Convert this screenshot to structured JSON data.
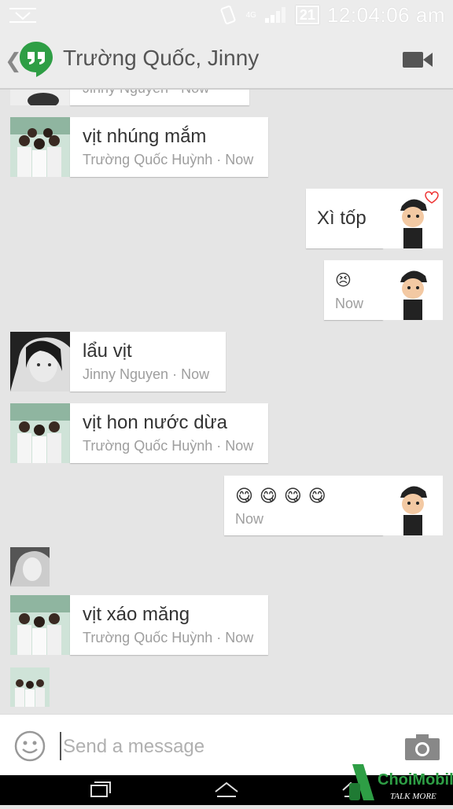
{
  "status_bar": {
    "network": "4G",
    "battery": "21",
    "time": "12:04:06 am"
  },
  "app_bar": {
    "title": "Trường Quốc, Jinny"
  },
  "messages": [
    {
      "direction": "in",
      "avatar": "group-photo",
      "text": "vịt nhúng mắm",
      "sender": "Trường Quốc Huỳnh",
      "time": "Now"
    },
    {
      "direction": "out",
      "text": "Xì tốp"
    },
    {
      "direction": "out",
      "emoji": "😣",
      "time": "Now"
    },
    {
      "direction": "in",
      "avatar": "jinny-photo",
      "text": "lẩu vịt",
      "sender": "Jinny Nguyen",
      "time": "Now"
    },
    {
      "direction": "in",
      "avatar": "group-photo",
      "text": "vịt hon nước dừa",
      "sender": "Trường Quốc Huỳnh",
      "time": "Now"
    },
    {
      "direction": "out",
      "emoji": "😋😋😋😋",
      "time": "Now"
    },
    {
      "direction": "in",
      "avatar": "group-photo",
      "text": "vịt xáo măng",
      "sender": "Trường Quốc Huỳnh",
      "time": "Now"
    }
  ],
  "partial_top": {
    "sender": "Jinny Nguyen",
    "time": "Now"
  },
  "composer": {
    "placeholder": "Send a message"
  },
  "watermark": {
    "brand": "ChoiMobile",
    "tagline": "TALK MORE"
  },
  "colors": {
    "hangouts_green": "#2e9e45",
    "background": "#e5e5e5"
  }
}
